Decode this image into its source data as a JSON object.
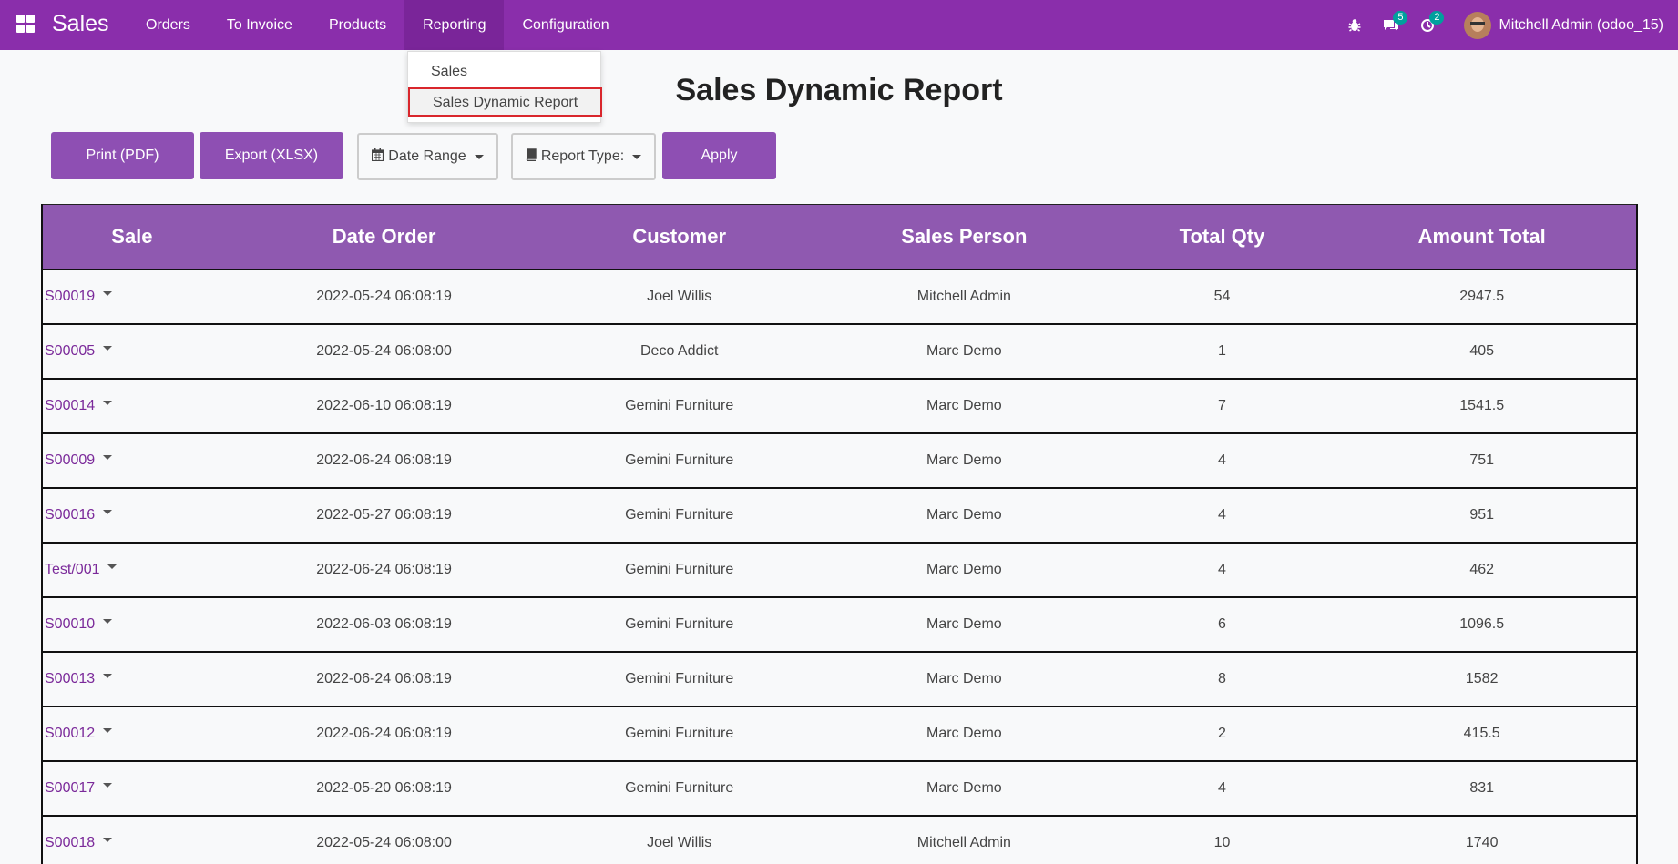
{
  "navbar": {
    "brand": "Sales",
    "menu": [
      "Orders",
      "To Invoice",
      "Products",
      "Reporting",
      "Configuration"
    ],
    "messages_count": "5",
    "activities_count": "2",
    "user_name": "Mitchell Admin (odoo_15)",
    "color": "#8a2eab"
  },
  "dropdown": {
    "items": [
      "Sales",
      "Sales Dynamic Report"
    ]
  },
  "page": {
    "title": "Sales Dynamic Report"
  },
  "toolbar": {
    "print": "Print (PDF)",
    "export": "Export (XLSX)",
    "date_range": "Date Range",
    "report_type": "Report Type:",
    "apply": "Apply"
  },
  "table": {
    "headers": [
      "Sale",
      "Date Order",
      "Customer",
      "Sales Person",
      "Total Qty",
      "Amount Total"
    ],
    "rows": [
      [
        "S00019",
        "2022-05-24 06:08:19",
        "Joel Willis",
        "Mitchell Admin",
        "54",
        "2947.5"
      ],
      [
        "S00005",
        "2022-05-24 06:08:00",
        "Deco Addict",
        "Marc Demo",
        "1",
        "405"
      ],
      [
        "S00014",
        "2022-06-10 06:08:19",
        "Gemini Furniture",
        "Marc Demo",
        "7",
        "1541.5"
      ],
      [
        "S00009",
        "2022-06-24 06:08:19",
        "Gemini Furniture",
        "Marc Demo",
        "4",
        "751"
      ],
      [
        "S00016",
        "2022-05-27 06:08:19",
        "Gemini Furniture",
        "Marc Demo",
        "4",
        "951"
      ],
      [
        "Test/001",
        "2022-06-24 06:08:19",
        "Gemini Furniture",
        "Marc Demo",
        "4",
        "462"
      ],
      [
        "S00010",
        "2022-06-03 06:08:19",
        "Gemini Furniture",
        "Marc Demo",
        "6",
        "1096.5"
      ],
      [
        "S00013",
        "2022-06-24 06:08:19",
        "Gemini Furniture",
        "Marc Demo",
        "8",
        "1582"
      ],
      [
        "S00012",
        "2022-06-24 06:08:19",
        "Gemini Furniture",
        "Marc Demo",
        "2",
        "415.5"
      ],
      [
        "S00017",
        "2022-05-20 06:08:19",
        "Gemini Furniture",
        "Marc Demo",
        "4",
        "831"
      ],
      [
        "S00018",
        "2022-05-24 06:08:00",
        "Joel Willis",
        "Mitchell Admin",
        "10",
        "1740"
      ]
    ]
  }
}
